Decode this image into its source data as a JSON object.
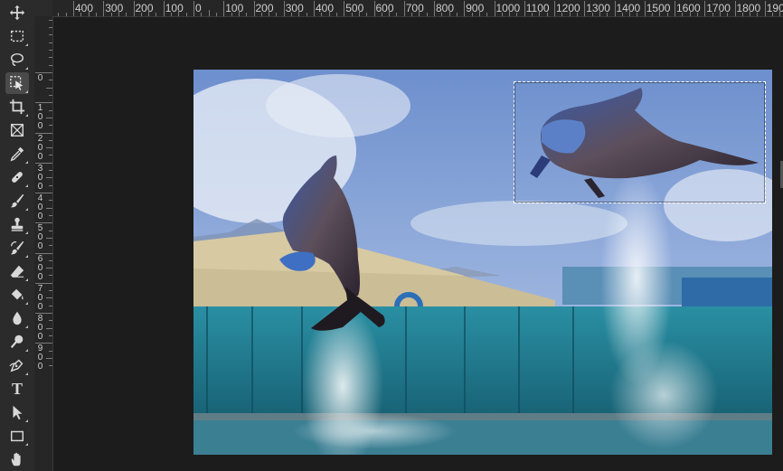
{
  "toolbar": {
    "tools": [
      {
        "name": "move-tool",
        "label": "Move Tool",
        "glyph": "move-icon"
      },
      {
        "name": "marquee-tool",
        "label": "Rectangular Marquee Tool",
        "glyph": "marquee-icon"
      },
      {
        "name": "lasso-tool",
        "label": "Lasso Tool",
        "glyph": "lasso-icon"
      },
      {
        "name": "object-selection-tool",
        "label": "Object Selection Tool",
        "glyph": "object-selection-icon",
        "active": true
      },
      {
        "name": "crop-tool",
        "label": "Crop Tool",
        "glyph": "crop-icon"
      },
      {
        "name": "frame-tool",
        "label": "Frame Tool",
        "glyph": "frame-icon"
      },
      {
        "name": "eyedropper-tool",
        "label": "Eyedropper Tool",
        "glyph": "eyedropper-icon"
      },
      {
        "name": "healing-brush-tool",
        "label": "Spot Healing Brush Tool",
        "glyph": "bandage-icon"
      },
      {
        "name": "brush-tool",
        "label": "Brush Tool",
        "glyph": "brush-icon"
      },
      {
        "name": "clone-stamp-tool",
        "label": "Clone Stamp Tool",
        "glyph": "stamp-icon"
      },
      {
        "name": "history-brush-tool",
        "label": "History Brush Tool",
        "glyph": "history-brush-icon"
      },
      {
        "name": "eraser-tool",
        "label": "Eraser Tool",
        "glyph": "eraser-icon"
      },
      {
        "name": "paint-bucket-tool",
        "label": "Paint Bucket Tool",
        "glyph": "bucket-icon"
      },
      {
        "name": "blur-tool",
        "label": "Blur Tool",
        "glyph": "drop-icon"
      },
      {
        "name": "dodge-tool",
        "label": "Dodge Tool",
        "glyph": "dodge-icon"
      },
      {
        "name": "pen-tool",
        "label": "Pen Tool",
        "glyph": "pen-icon"
      },
      {
        "name": "type-tool",
        "label": "Horizontal Type Tool",
        "glyph": "type-icon",
        "text": "T"
      },
      {
        "name": "path-selection-tool",
        "label": "Path Selection Tool",
        "glyph": "arrow-icon"
      },
      {
        "name": "rectangle-tool",
        "label": "Rectangle Tool",
        "glyph": "rectangle-icon"
      },
      {
        "name": "hand-tool",
        "label": "Hand Tool",
        "glyph": "hand-icon"
      }
    ]
  },
  "rulers": {
    "horizontal_labels": [
      "400",
      "300",
      "200",
      "100",
      "0",
      "100",
      "200",
      "300",
      "400",
      "500",
      "600",
      "700",
      "800",
      "900",
      "1000",
      "1100",
      "1200",
      "1300",
      "1400",
      "1500",
      "1600",
      "1700",
      "1800",
      "190"
    ],
    "vertical_labels": [
      "0",
      "100",
      "200",
      "300",
      "400",
      "500",
      "600",
      "700",
      "800",
      "900"
    ]
  },
  "document": {
    "image_description": "dolphin-show-photo",
    "selection": "rectangular-marquee-selection"
  },
  "colors": {
    "panel": "#2b2b2b",
    "background": "#1e1e1e",
    "sky": "#7c9ad0",
    "water": "#1f6b7f"
  }
}
